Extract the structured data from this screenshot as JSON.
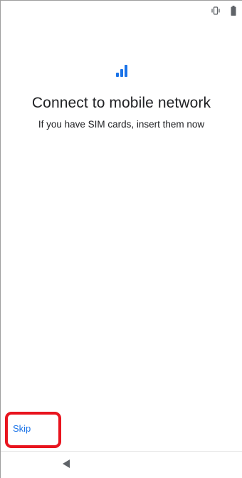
{
  "status_bar": {
    "icons": [
      "vibrate-icon",
      "battery-icon"
    ]
  },
  "main": {
    "icon": "signal-bars-icon",
    "title": "Connect to mobile network",
    "subtitle": "If you have SIM cards, insert them now"
  },
  "footer": {
    "skip_label": "Skip"
  },
  "navigation": {
    "back_icon": "back-triangle-icon"
  },
  "colors": {
    "accent": "#1a73e8",
    "highlight": "#e8141e",
    "text": "#202124"
  }
}
